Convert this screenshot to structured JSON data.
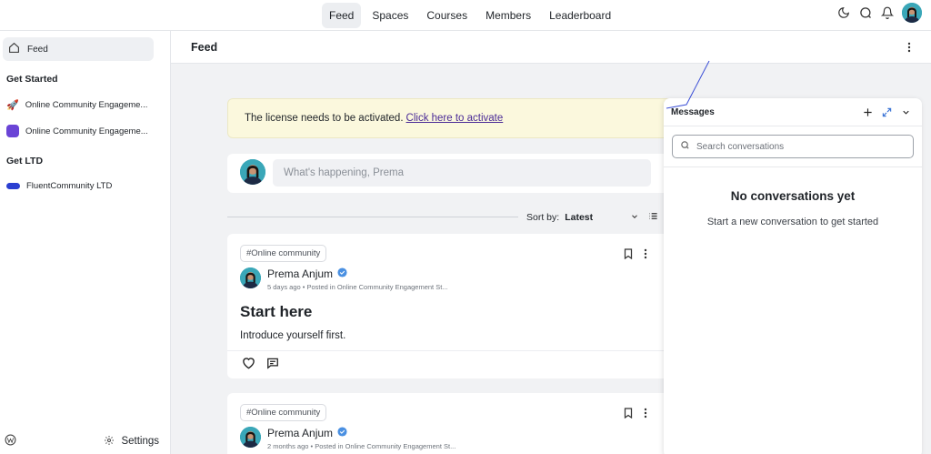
{
  "topnav": {
    "items": [
      {
        "label": "Feed",
        "active": true
      },
      {
        "label": "Spaces",
        "active": false
      },
      {
        "label": "Courses",
        "active": false
      },
      {
        "label": "Members",
        "active": false
      },
      {
        "label": "Leaderboard",
        "active": false
      }
    ],
    "icons": [
      "moon-icon",
      "search-icon",
      "bell-icon",
      "avatar"
    ]
  },
  "sidebar": {
    "feed_label": "Feed",
    "sections": [
      {
        "heading": "Get Started",
        "items": [
          {
            "label": "Online Community Engageme...",
            "icon": "rocket-icon"
          },
          {
            "label": "Online Community Engageme...",
            "icon": "purple-square-icon"
          }
        ]
      },
      {
        "heading": "Get LTD",
        "items": [
          {
            "label": "FluentCommunity LTD",
            "icon": "blue-pill-icon"
          }
        ]
      }
    ],
    "footer": {
      "settings_label": "Settings"
    }
  },
  "header": {
    "title": "Feed"
  },
  "banner": {
    "text": "The license needs to be activated.",
    "link": "Click here to activate"
  },
  "composer": {
    "placeholder": "What's happening, Prema"
  },
  "sort": {
    "label": "Sort by:",
    "value": "Latest"
  },
  "posts": [
    {
      "tag": "#Online community",
      "author": "Prema Anjum",
      "meta": "5 days ago • Posted in Online Community Engagement St...",
      "title": "Start here",
      "body": "Introduce yourself first."
    },
    {
      "tag": "#Online community",
      "author": "Prema Anjum",
      "meta": "2 months ago • Posted in Online Community Engagement St..."
    }
  ],
  "messages": {
    "title": "Messages",
    "search_placeholder": "Search conversations",
    "empty_title": "No conversations yet",
    "empty_subtitle": "Start a new conversation to get started"
  },
  "colors": {
    "banner_bg": "#fbf8dd",
    "link": "#4a2a96",
    "verified": "#4a90e2",
    "pointer_line": "#3b4fd6"
  }
}
